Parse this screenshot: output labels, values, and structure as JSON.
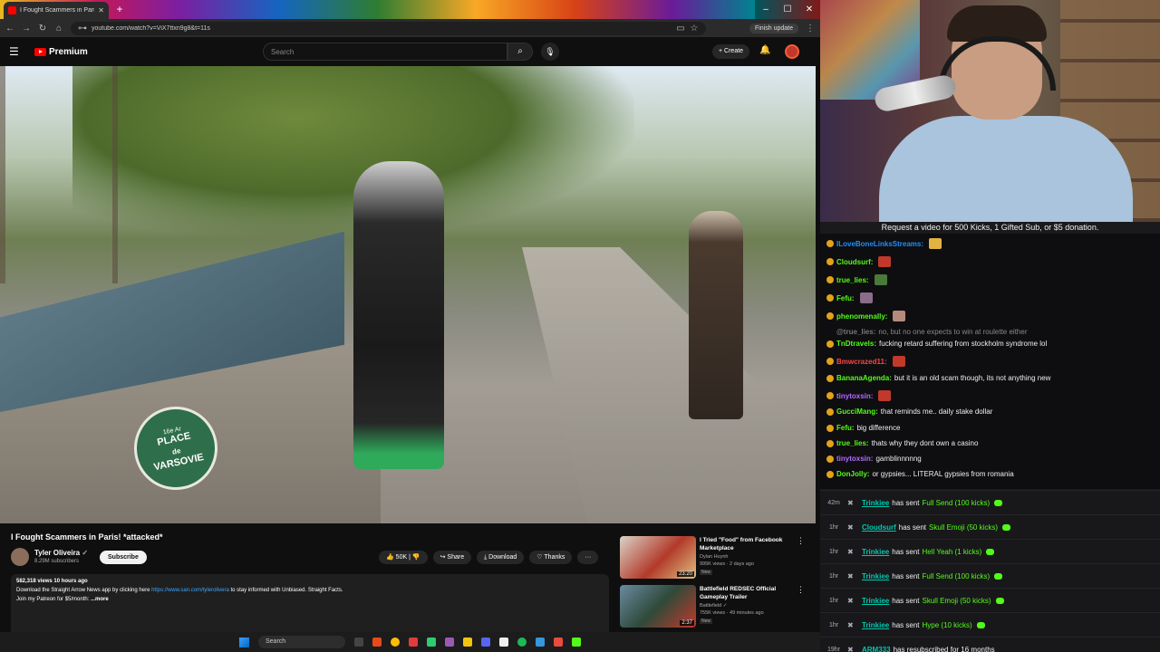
{
  "browser": {
    "tab_title": "I Fought Scammers in Paris! *at",
    "url": "youtube.com/watch?v=ViX7ttxn9g8&t=11s",
    "finish_update": "Finish update"
  },
  "youtube": {
    "logo_text": "Premium",
    "search_placeholder": "Search",
    "create_label": "Create"
  },
  "video_overlay": {
    "sign_arrow": "16e Ar",
    "sign_name_line1": "PLACE",
    "sign_name_line2": "de",
    "sign_name_line3": "VARSOVIE"
  },
  "video": {
    "title": "I Fought Scammers in Paris! *attacked*",
    "channel": "Tyler Oliveira",
    "subscribers": "8.29M subscribers",
    "subscribe_label": "Subscribe",
    "likes": "50K",
    "share_label": "Share",
    "download_label": "Download",
    "thanks_label": "Thanks",
    "views_meta": "582,318 views  10 hours ago",
    "desc_line1_pre": "Download the Straight Arrow News app by clicking here ",
    "desc_link": "https://www.san.com/tylerolivera",
    "desc_line1_post": " to stay informed with Unbiased. Straight Facts.",
    "desc_line2": "Join my Patreon for $5/month: ",
    "more_label": "...more"
  },
  "recommendations": [
    {
      "title": "I Tried \"Food\" from Facebook Marketplace",
      "channel": "Dylan Huynh",
      "meta": "995K views · 2 days ago",
      "badge": "New",
      "duration": "23:20"
    },
    {
      "title": "Battlefield REDSEC Official Gameplay Trailer",
      "channel": "Battlefield",
      "meta": "755K views · 49 minutes ago",
      "badge": "New",
      "duration": "2:37"
    }
  ],
  "taskbar": {
    "search_label": "Search"
  },
  "stream": {
    "goal_text": "Request a video for 500 Kicks, 1 Gifted Sub, or $5 donation.",
    "chat": [
      {
        "user": "ILoveBoneLinksStreams:",
        "text": "",
        "color": "#1e90ff"
      },
      {
        "user": "Cloudsurf:",
        "text": "",
        "color": "#53fc18"
      },
      {
        "user": "true_lies:",
        "text": "",
        "color": "#53fc18"
      },
      {
        "user": "Fefu:",
        "text": "",
        "color": "#53fc18"
      },
      {
        "user": "phenomenally:",
        "text": "",
        "color": "#53fc18"
      },
      {
        "user": "@true_lies:",
        "text": "no, but no one expects to win at roulette either",
        "color": "#777777"
      },
      {
        "user": "TnDtravels:",
        "text": "fucking retard suffering from stockholm syndrome lol",
        "color": "#53fc18"
      },
      {
        "user": "Bmwcrazed11:",
        "text": "",
        "color": "#ff4444"
      },
      {
        "user": "BananaAgenda:",
        "text": "but it is an old scam though, its not anything new",
        "color": "#53fc18"
      },
      {
        "user": "tinytoxsin:",
        "text": "",
        "color": "#b26bff"
      },
      {
        "user": "GucciMang:",
        "text": "that reminds me.. daily stake dollar",
        "color": "#53fc18"
      },
      {
        "user": "Fefu:",
        "text": "big difference",
        "color": "#53fc18"
      },
      {
        "user": "true_lies:",
        "text": "thats why they dont own a casino",
        "color": "#53fc18"
      },
      {
        "user": "tinytoxsin:",
        "text": "gamblinnnnng",
        "color": "#b26bff"
      },
      {
        "user": "DonJolly:",
        "text": "or gypsies... LITERAL gypsies from romania",
        "color": "#53fc18"
      }
    ],
    "events": [
      {
        "time": "42m",
        "user": "Trinkiee",
        "action": "has sent",
        "item": "Full Send (100 kicks)"
      },
      {
        "time": "1hr",
        "user": "Cloudsurf",
        "action": "has sent",
        "item": "Skull Emoji (50 kicks)"
      },
      {
        "time": "1hr",
        "user": "Trinkiee",
        "action": "has sent",
        "item": "Hell Yeah (1 kicks)"
      },
      {
        "time": "1hr",
        "user": "Trinkiee",
        "action": "has sent",
        "item": "Full Send (100 kicks)"
      },
      {
        "time": "1hr",
        "user": "Trinkiee",
        "action": "has sent",
        "item": "Skull Emoji (50 kicks)"
      },
      {
        "time": "1hr",
        "user": "Trinkiee",
        "action": "has sent",
        "item": "Hype (10 kicks)"
      },
      {
        "time": "19hr",
        "user": "ARM333",
        "action": "has resubscribed for 16 months",
        "item": ""
      }
    ]
  }
}
